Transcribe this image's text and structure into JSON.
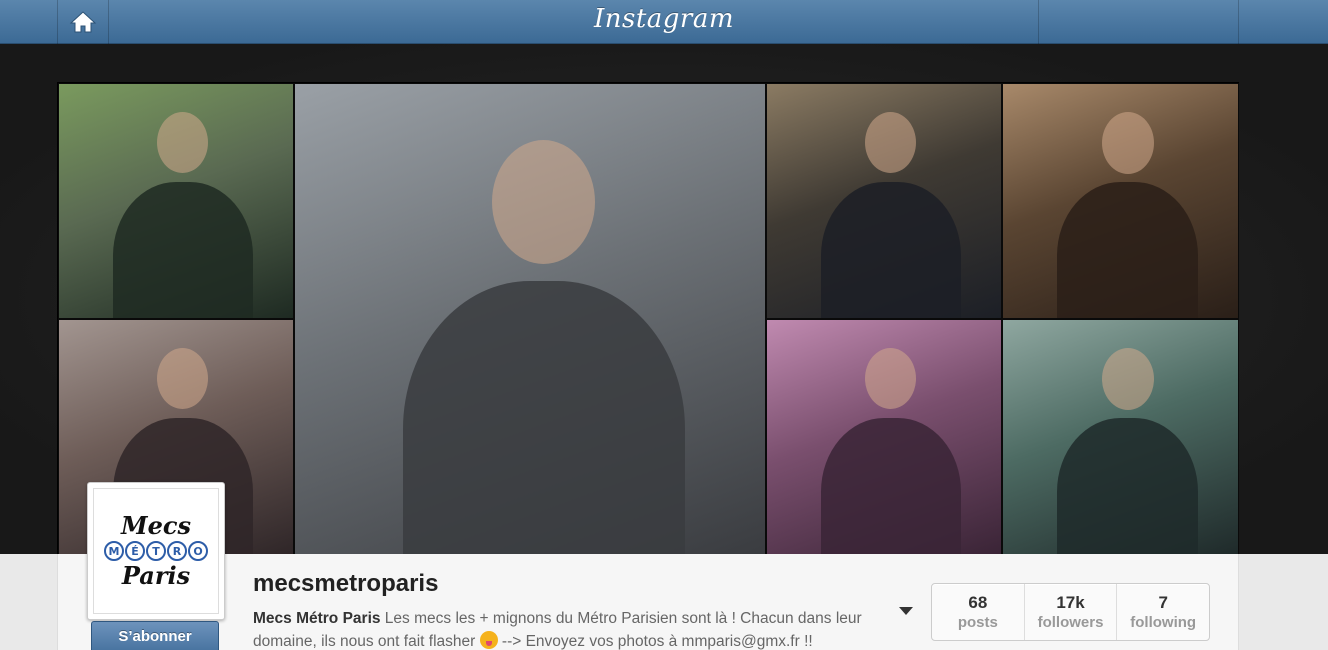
{
  "header": {
    "logo": "Instagram",
    "home_icon": "home-icon"
  },
  "photos": [
    {
      "id": "photo-1",
      "desc": "man in parka using phone on metro seat",
      "colors": [
        "#5a6a52",
        "#1e2a22",
        "#7a9a5e"
      ]
    },
    {
      "id": "photo-2",
      "desc": "man with grey scarf holding pole",
      "colors": [
        "#6c7176",
        "#3a3c40",
        "#9aa0a6"
      ]
    },
    {
      "id": "photo-3",
      "desc": "man in navy peacoat by window",
      "colors": [
        "#3f3a33",
        "#1c1f26",
        "#8b7b63"
      ]
    },
    {
      "id": "photo-4",
      "desc": "bearded man with earphones",
      "colors": [
        "#5a4532",
        "#2a1f18",
        "#a8896a"
      ]
    },
    {
      "id": "photo-5",
      "desc": "man in grey beanie",
      "colors": [
        "#6e5d58",
        "#2f2628",
        "#a29590"
      ]
    },
    {
      "id": "photo-6",
      "desc": "man in purple beanie",
      "colors": [
        "#7a4f6e",
        "#3a2436",
        "#c08ab0"
      ]
    },
    {
      "id": "photo-7",
      "desc": "man in black jacket on green seat",
      "colors": [
        "#4d6b63",
        "#1f2a2a",
        "#8fa7a0"
      ]
    }
  ],
  "profile": {
    "avatar": {
      "line1": "Mecs",
      "metro": [
        "M",
        "É",
        "T",
        "R",
        "O"
      ],
      "line2": "Paris"
    },
    "follow_label": "S’abonner",
    "username": "mecsmetroparis",
    "full_name": "Mecs Métro Paris",
    "bio_part1": " Les mecs les + mignons du Métro Parisien sont là ! Chacun dans leur domaine, ils nous ont fait flasher ",
    "bio_part2": " --> Envoyez vos photos à mmparis@gmx.fr !!",
    "stats": [
      {
        "num": "68",
        "label": "posts"
      },
      {
        "num": "17k",
        "label": "followers"
      },
      {
        "num": "7",
        "label": "following"
      }
    ]
  }
}
